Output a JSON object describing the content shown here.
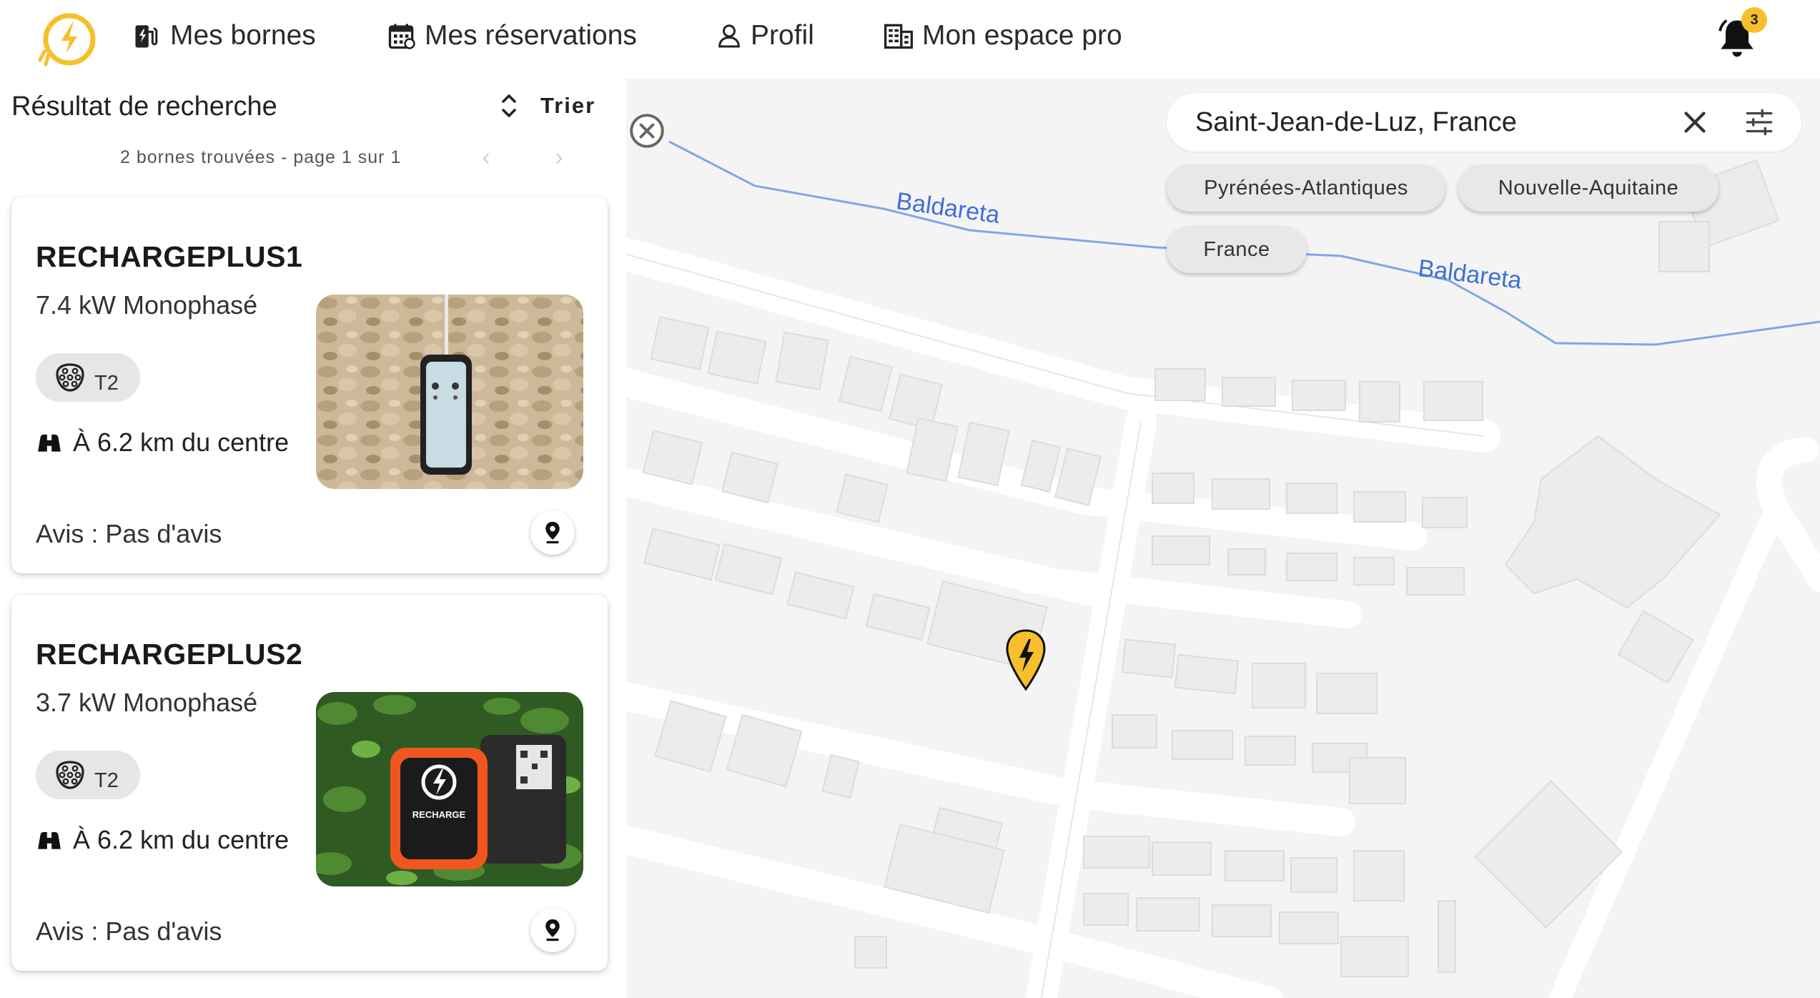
{
  "nav": {
    "items": [
      {
        "label": "Mes bornes",
        "icon": "ev-station-icon"
      },
      {
        "label": "Mes réservations",
        "icon": "calendar-icon"
      },
      {
        "label": "Profil",
        "icon": "user-icon"
      },
      {
        "label": "Mon espace pro",
        "icon": "building-icon"
      }
    ],
    "notifications_count": "3",
    "brand_color": "#f6bf2b"
  },
  "results": {
    "title": "Résultat de recherche",
    "sort_label": "Trier",
    "count_text": "2 bornes trouvées - page 1 sur 1",
    "prev": "‹",
    "next": "›"
  },
  "stations": [
    {
      "name": "RECHARGEPLUS1",
      "power": "7.4 kW Monophasé",
      "plug": "T2",
      "distance": "À 6.2 km du centre",
      "reviews": "Avis : Pas d'avis",
      "photo": "wall-charger-on-stone-wall"
    },
    {
      "name": "RECHARGEPLUS2",
      "power": "3.7 kW Monophasé",
      "plug": "T2",
      "distance": "À 6.2 km du centre",
      "reviews": "Avis : Pas d'avis",
      "photo": "recharge-box-on-leaves",
      "photo_text": "RECHARGE"
    }
  ],
  "map": {
    "search_value": "Saint-Jean-de-Luz, France",
    "suggestions": [
      "Pyrénées-Atlantiques",
      "Nouvelle-Aquitaine",
      "France"
    ],
    "street_labels": [
      "Baldareta",
      "Baldareta"
    ],
    "river_color": "#7fa6e8",
    "marker_color": "#f6bf2b"
  }
}
